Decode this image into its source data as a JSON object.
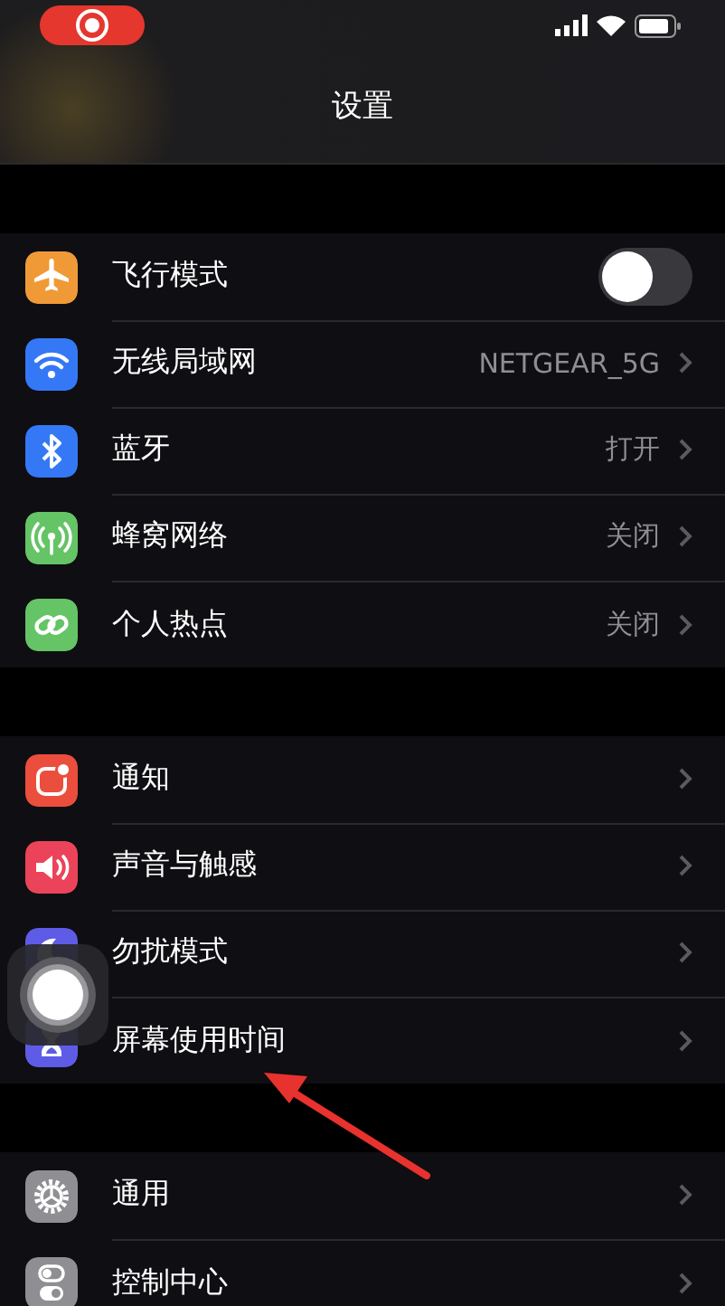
{
  "status_bar": {
    "recording": true
  },
  "navigation": {
    "title": "设置"
  },
  "groups": [
    {
      "rows": [
        {
          "color": "#f09a37",
          "label": "飞行模式",
          "kind": "toggle",
          "on": false
        },
        {
          "color": "#3478f6",
          "label": "无线局域网",
          "value": "NETGEAR_5G",
          "kind": "link"
        },
        {
          "color": "#3478f6",
          "label": "蓝牙",
          "value": "打开",
          "kind": "link"
        },
        {
          "color": "#65c466",
          "label": "蜂窝网络",
          "value": "关闭",
          "kind": "link"
        },
        {
          "color": "#65c466",
          "label": "个人热点",
          "value": "关闭",
          "kind": "link"
        }
      ]
    },
    {
      "rows": [
        {
          "color": "#eb4e3d",
          "label": "通知",
          "kind": "link"
        },
        {
          "color": "#eb445a",
          "label": "声音与触感",
          "kind": "link"
        },
        {
          "color": "#5e5ce6",
          "label": "勿扰模式",
          "kind": "link"
        },
        {
          "color": "#5e5ce6",
          "label": "屏幕使用时间",
          "kind": "link"
        }
      ]
    },
    {
      "rows": [
        {
          "color": "#8e8e93",
          "label": "通用",
          "kind": "link"
        },
        {
          "color": "#8e8e93",
          "label": "控制中心",
          "kind": "link"
        }
      ]
    }
  ]
}
